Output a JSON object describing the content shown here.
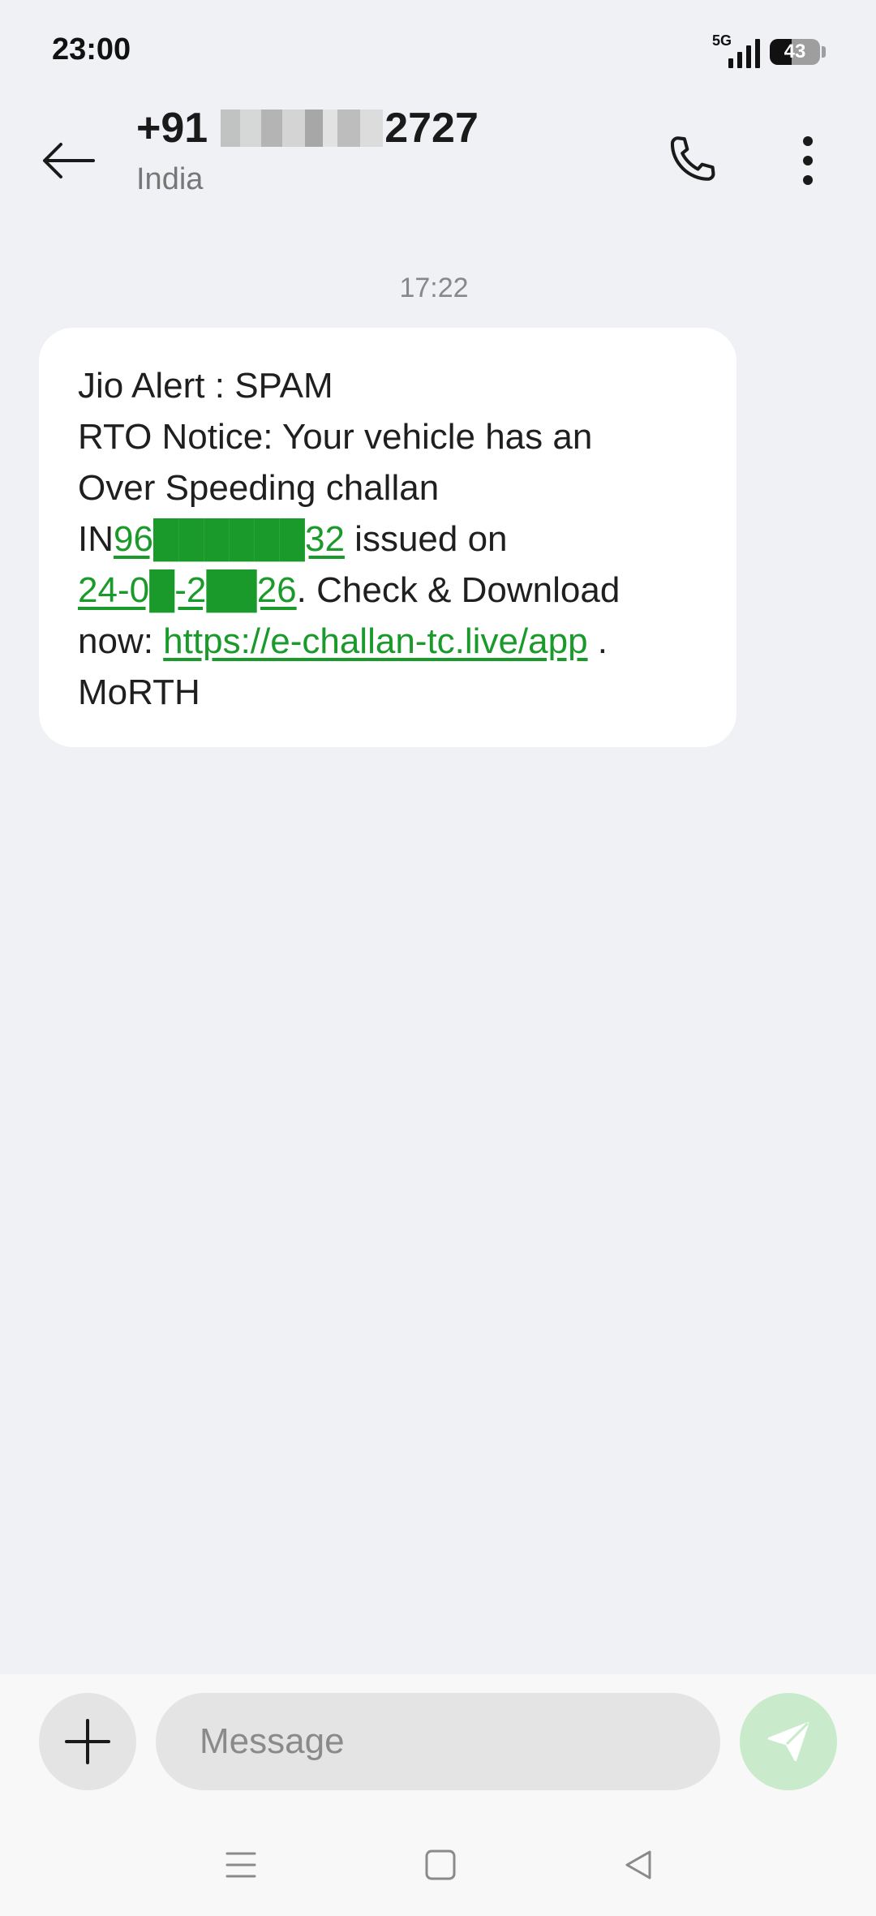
{
  "status_bar": {
    "time": "23:00",
    "network": "5G",
    "battery_level": "43",
    "battery_fraction": 0.43
  },
  "header": {
    "contact_prefix": "+91",
    "contact_suffix": "2727",
    "contact_subtitle": "India",
    "icons": [
      "back-arrow-icon",
      "phone-icon",
      "more-vert-icon"
    ]
  },
  "conversation": {
    "timestamp": "17:22",
    "message": {
      "line1": "Jio Alert : SPAM",
      "line2": "RTO Notice: Your vehicle has an",
      "line3": "Over Speeding challan",
      "line4_prefix": "IN",
      "challan_number": "96██████32",
      "line4_suffix": " issued on",
      "date_link": "24-0█-2██26",
      "line5_suffix": ". Check & Download",
      "line6_prefix": "now: ",
      "url": "https://e-challan-tc.live/app",
      "line6_suffix": " .",
      "line7": "MoRTH"
    },
    "link_color": "#1a9a2a"
  },
  "composer": {
    "placeholder": "Message",
    "icons": [
      "plus-icon",
      "send-icon"
    ]
  },
  "nav": {
    "icons": [
      "recents-icon",
      "home-icon",
      "back-icon"
    ]
  }
}
